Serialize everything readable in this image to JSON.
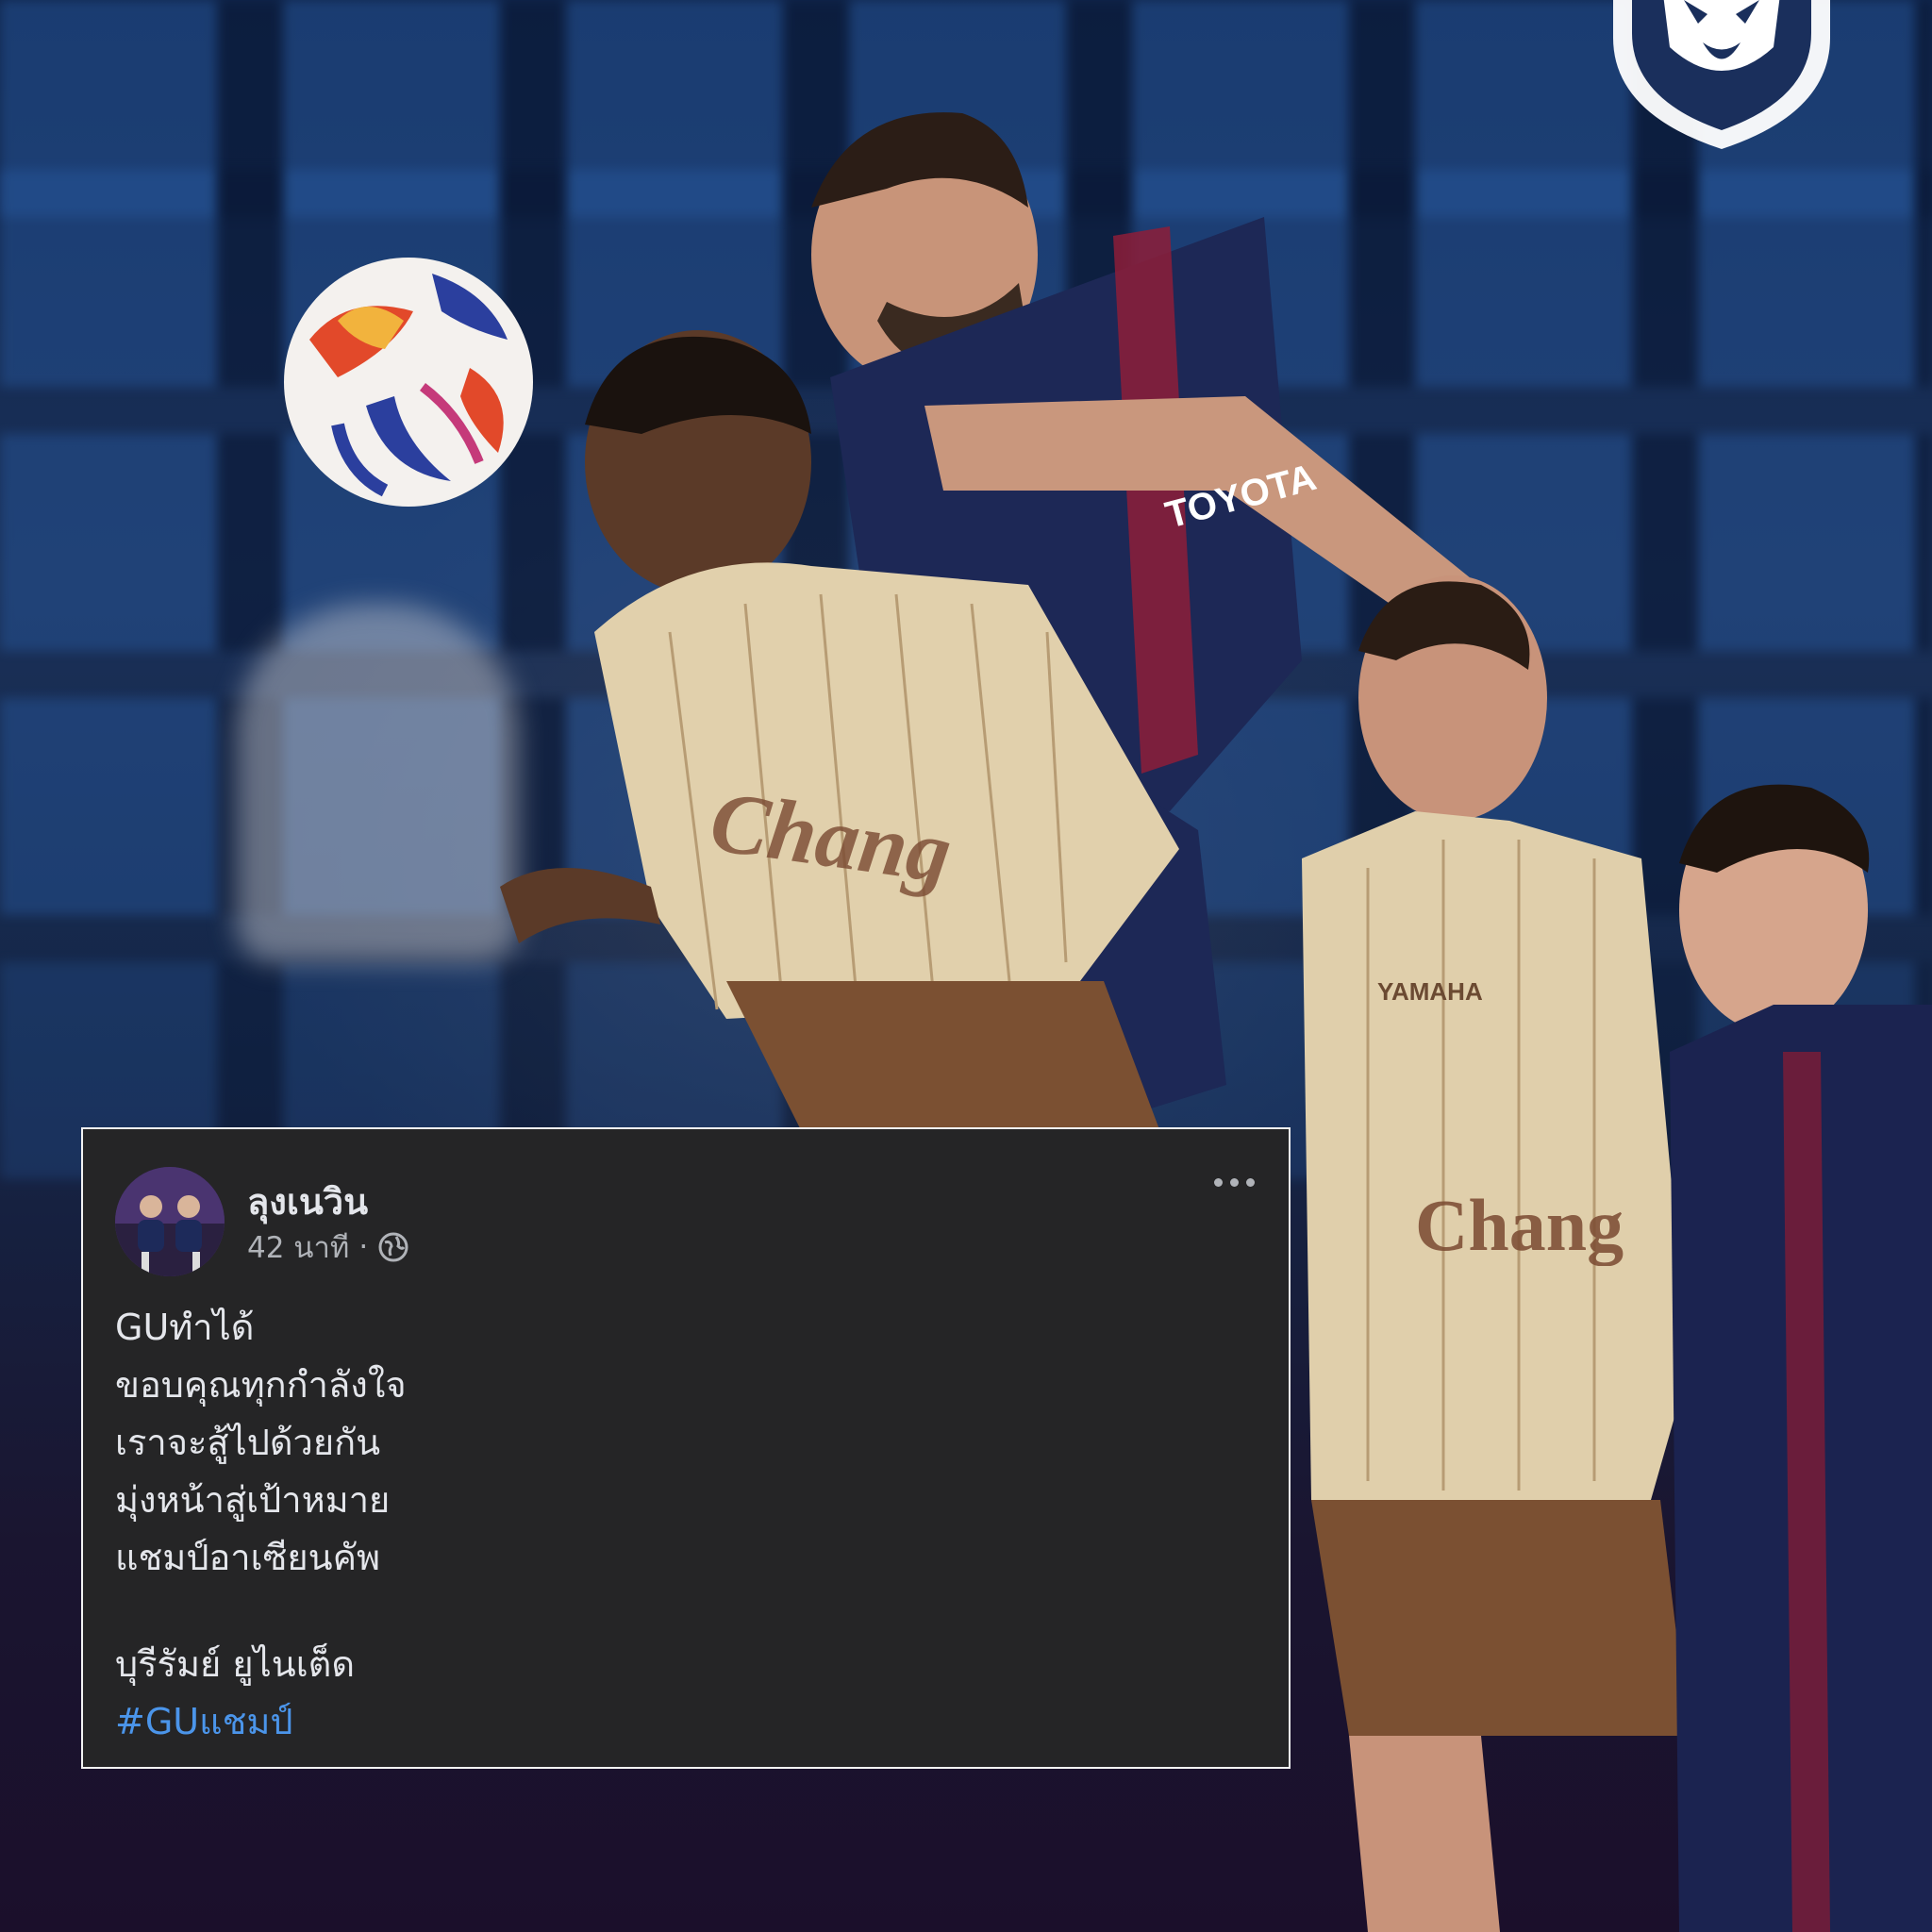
{
  "post": {
    "author": "ลุงเนวิน",
    "time": "42 นาที",
    "separator": "·",
    "privacy_icon": "globe-icon",
    "more_icon": "more-options-icon",
    "lines": [
      "GUทำได้",
      "ขอบคุณทุกกำลังใจ",
      "เราจะสู้ไปด้วยกัน",
      "มุ่งหน้าสู่เป้าหมาย",
      "แชมป์อาเซียนคัพ"
    ],
    "signature": "บุรีรัมย์ ยูไนเต็ด",
    "hashtag": "#GUแชมป์"
  },
  "photo": {
    "jersey_sponsor_left": "Chang",
    "jersey_sponsor_right": "Chang",
    "jersey_brand": "YAMAHA",
    "shirt_sponsor": "TOYOTA"
  },
  "colors": {
    "card_bg": "#252526",
    "text_primary": "#e4e6eb",
    "text_secondary": "#b0b3b8",
    "hashtag": "#4b95ea"
  }
}
